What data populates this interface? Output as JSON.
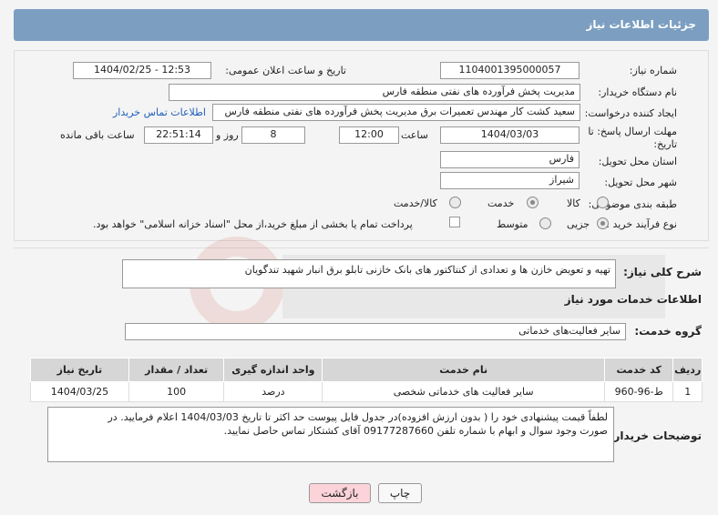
{
  "header": {
    "title": "جزئیات اطلاعات نیاز"
  },
  "form": {
    "need_number_label": "شماره نیاز:",
    "need_number": "1104001395000057",
    "announce_label": "تاریخ و ساعت اعلان عمومی:",
    "announce_value": "1404/02/25 - 12:53",
    "buyer_org_label": "نام دستگاه خریدار:",
    "buyer_org": "مدیریت پخش فرآورده های نفتی منطقه فارس",
    "creator_label": "ایجاد کننده درخواست:",
    "creator": "سعید کشت کار مهندس تعمیرات برق مدیریت پخش فرآورده های نفتی منطقه فارس",
    "contact_link": "اطلاعات تماس خریدار",
    "deadline_label_1": "مهلت ارسال پاسخ: تا",
    "deadline_label_2": "تاریخ:",
    "deadline_date": "1404/03/03",
    "time_label": "ساعت",
    "deadline_time": "12:00",
    "days_value": "8",
    "days_label": "روز و",
    "remaining_time": "22:51:14",
    "remaining_label": "ساعت باقی مانده",
    "province_label": "استان محل تحویل:",
    "province": "فارس",
    "city_label": "شهر محل تحویل:",
    "city": "شیراز",
    "category_label": "طبقه بندی موضوعی:",
    "category_options": [
      "کالا",
      "خدمت",
      "کالا/خدمت"
    ],
    "category_selected": "خدمت",
    "process_label": "نوع فرآیند خرید :",
    "process_options": [
      "جزیی",
      "متوسط"
    ],
    "process_selected": "جزیی",
    "payment_note": "پرداخت تمام یا بخشی از مبلغ خرید،از محل \"اسناد خزانه اسلامی\" خواهد بود."
  },
  "summary": {
    "label": "شرح کلی نیاز:",
    "text": "تهیه و تعویض خازن ها و تعدادی از کنتاکتور های  بانک خازنی تابلو برق انبار شهید تندگویان"
  },
  "services": {
    "section_title": "اطلاعات خدمات مورد نیاز",
    "group_label": "گروه خدمت:",
    "group_value": "سایر فعالیت‌های خدماتی",
    "columns": [
      "ردیف",
      "کد خدمت",
      "نام خدمت",
      "واحد اندازه گیری",
      "تعداد / مقدار",
      "تاریخ نیاز"
    ],
    "rows": [
      [
        "1",
        "ط-96-960",
        "سایر فعالیت های خدماتی شخصی",
        "درصد",
        "100",
        "1404/03/25"
      ]
    ]
  },
  "buyer_notes": {
    "label": "توضیحات خریدار:",
    "line1": "لطفاً قیمت پیشنهادی خود را ( بدون ارزش افزوده)در جدول فایل پیوست حد اکثر تا تاریخ 1404/03/03 اعلام فرمایید.  در",
    "line2": "صورت وجود سوال و ابهام با شماره تلفن 09177287660  آقای کشتکار تماس حاصل نمایید."
  },
  "buttons": {
    "print": "چاپ",
    "back": "بازگشت"
  },
  "colors": {
    "header": "#7c9fc1",
    "back_button": "#fbd3d8",
    "link": "#1f5fb8"
  }
}
